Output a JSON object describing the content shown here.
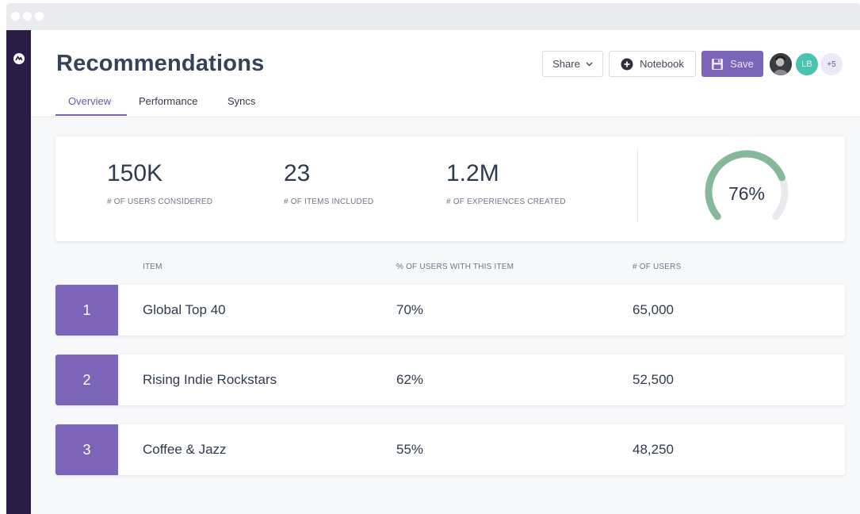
{
  "header": {
    "title": "Recommendations",
    "tabs": [
      {
        "label": "Overview",
        "active": true
      },
      {
        "label": "Performance",
        "active": false
      },
      {
        "label": "Syncs",
        "active": false
      }
    ],
    "share_label": "Share",
    "notebook_label": "Notebook",
    "save_label": "Save",
    "avatars": {
      "initials": "LB",
      "more": "+5"
    },
    "icons": [
      "chevron-down-icon",
      "plus-circle-icon",
      "floppy-disk-icon",
      "user-photo-avatar"
    ]
  },
  "stats": [
    {
      "value": "150K",
      "label": "# OF USERS CONSIDERED"
    },
    {
      "value": "23",
      "label": "# OF ITEMS INCLUDED"
    },
    {
      "value": "1.2M",
      "label": "# OF EXPERIENCES CREATED"
    }
  ],
  "gauge": {
    "text": "76%",
    "fraction": 0.76
  },
  "table": {
    "headers": {
      "item": "ITEM",
      "pct": "% OF USERS WITH THIS ITEM",
      "users": "# OF USERS"
    },
    "rows": [
      {
        "rank": "1",
        "item": "Global Top 40",
        "pct": "70%",
        "users": "65,000"
      },
      {
        "rank": "2",
        "item": "Rising Indie Rockstars",
        "pct": "62%",
        "users": "52,500"
      },
      {
        "rank": "3",
        "item": "Coffee & Jazz",
        "pct": "55%",
        "users": "48,250"
      }
    ]
  },
  "colors": {
    "accent": "#7c65b8",
    "sidebar": "#2a1c45",
    "gauge": "#86b99a",
    "gauge_track": "#e8eaee",
    "teal_avatar": "#49c4b0"
  }
}
